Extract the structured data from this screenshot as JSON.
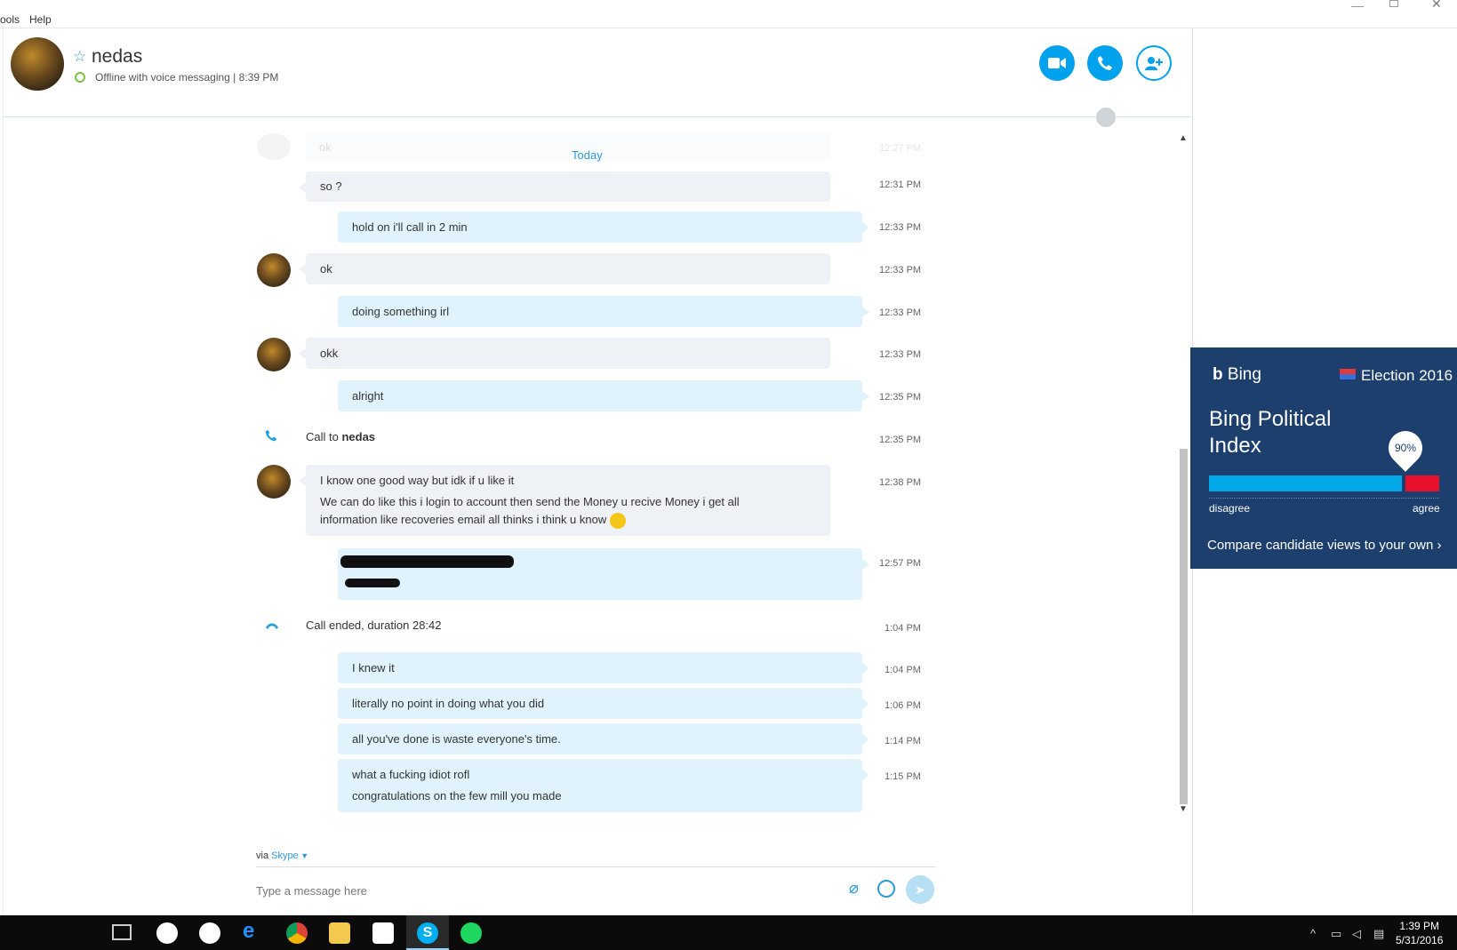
{
  "menu": {
    "tools": "ools",
    "help": "Help"
  },
  "header": {
    "contact_name": "nedas",
    "status": "Offline with voice messaging  |  8:39 PM"
  },
  "conversation": {
    "day_label": "Today",
    "faded_preview": {
      "text": "ok",
      "time": "12:27 PM"
    },
    "messages": [
      {
        "dir": "in",
        "text": "so ?",
        "time": "12:31 PM"
      },
      {
        "dir": "out",
        "text": "hold on i'll call in 2 min",
        "time": "12:33 PM"
      },
      {
        "dir": "in",
        "text": "ok",
        "time": "12:33 PM"
      },
      {
        "dir": "out",
        "text": "doing something irl",
        "time": "12:33 PM"
      },
      {
        "dir": "in",
        "text": "okk",
        "time": "12:33 PM"
      },
      {
        "dir": "out",
        "text": "alright",
        "time": "12:35 PM"
      },
      {
        "dir": "event",
        "text_prefix": "Call to ",
        "text_bold": "nedas",
        "time": "12:35 PM"
      },
      {
        "dir": "in",
        "line1": "I know one good way but idk if u like it",
        "line2": "We can do like this i login to account then send the Money u recive Money i get all information like recoveries email all thinks i think u know",
        "time": "12:38 PM"
      },
      {
        "dir": "out",
        "text": "",
        "time": "12:57 PM"
      },
      {
        "dir": "event",
        "text": "Call ended, duration 28:42",
        "time": "1:04 PM"
      },
      {
        "dir": "out",
        "text": "I knew it",
        "time": "1:04 PM"
      },
      {
        "dir": "out",
        "text": "literally no point in doing what you did",
        "time": "1:06 PM"
      },
      {
        "dir": "out",
        "text": "all you've done is waste everyone's time.",
        "time": "1:14 PM"
      },
      {
        "dir": "out",
        "line1": "what a fucking idiot rofl",
        "line2": "congratulations on the few mill you made",
        "time": "1:15 PM"
      }
    ]
  },
  "composer": {
    "via_label": "via ",
    "via_link": "Skype",
    "placeholder": "Type a message here"
  },
  "ad": {
    "brand": "Bing",
    "election": "Election 2016",
    "title_line1": "Bing Political",
    "title_line2": "Index",
    "percent_label": "90%",
    "agree_fraction": 0.9,
    "disagree_label": "disagree",
    "agree_label": "agree",
    "cta": "Compare candidate views to your own",
    "colors": {
      "background": "#1d3f6e",
      "disagree": "#00a8e8",
      "agree": "#e8112d"
    }
  },
  "taskbar": {
    "apps": [
      "task-view-icon",
      "app-icon",
      "app-icon-2",
      "edge-icon",
      "chrome-icon",
      "file-explorer-icon",
      "store-icon",
      "skype-icon",
      "spotify-icon"
    ],
    "clock_time": "1:39 PM",
    "clock_date": "5/31/2016"
  },
  "colors": {
    "accent": "#00a2ed",
    "incoming_bubble": "#eef1f5",
    "outgoing_bubble": "#e0f3fc"
  }
}
